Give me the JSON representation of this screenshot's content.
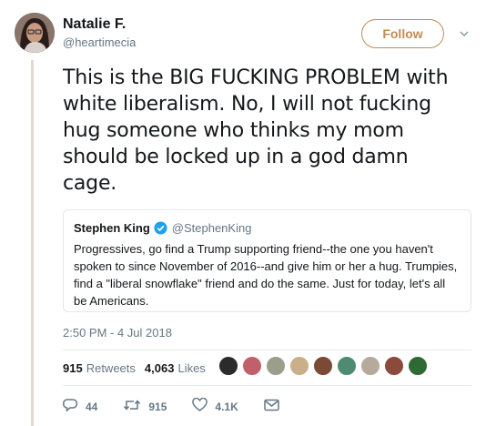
{
  "author": {
    "name": "Natalie F.",
    "handle": "@heartimecia"
  },
  "follow_label": "Follow",
  "tweet_text": "This is the BIG FUCKING PROBLEM with white liberalism. No, I will not fucking hug someone who thinks my mom should be locked up in a god damn cage.",
  "quote": {
    "name": "Stephen King",
    "handle": "@StephenKing",
    "text": "Progressives, go find a Trump supporting friend--the one you haven't spoken to since November of 2016--and give him or her a hug. Trumpies, find a \"liberal snowflake\" friend and do the same. Just for today, let's all be Americans."
  },
  "timestamp": "2:50 PM - 4 Jul 2018",
  "stats": {
    "retweets_count": "915",
    "retweets_label": "Retweets",
    "likes_count": "4,063",
    "likes_label": "Likes"
  },
  "actions": {
    "replies": "44",
    "retweets": "915",
    "likes": "4.1K"
  },
  "colors": {
    "accent": "#c28b54",
    "verified": "#1da1f2",
    "thread_line": "#e1d8cf"
  },
  "icons": [
    "reply-icon",
    "retweet-icon",
    "heart-icon",
    "message-icon",
    "verified-badge-icon",
    "chevron-down-icon"
  ]
}
